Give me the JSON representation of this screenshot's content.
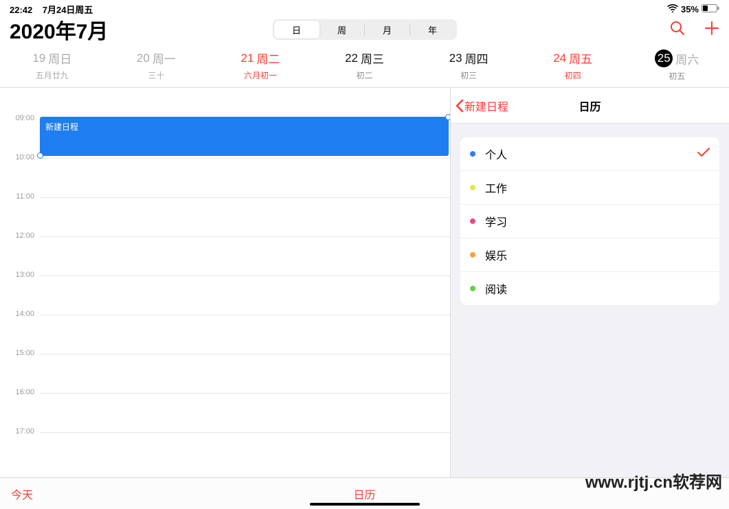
{
  "status": {
    "time": "22:42",
    "date": "7月24日周五",
    "battery_percent": "35%"
  },
  "header": {
    "title": "2020年7月",
    "segments": {
      "day": "日",
      "week": "周",
      "month": "月",
      "year": "年"
    }
  },
  "week": [
    {
      "main_num": "19",
      "main_wd": "周日",
      "sub": "五月廿九",
      "cls": "past"
    },
    {
      "main_num": "20",
      "main_wd": "周一",
      "sub": "三十",
      "cls": "past"
    },
    {
      "main_num": "21",
      "main_wd": "周二",
      "sub": "六月初一",
      "cls": "selected"
    },
    {
      "main_num": "22",
      "main_wd": "周三",
      "sub": "初二",
      "cls": ""
    },
    {
      "main_num": "23",
      "main_wd": "周四",
      "sub": "初三",
      "cls": ""
    },
    {
      "main_num": "24",
      "main_wd": "周五",
      "sub": "初四",
      "cls": "selected"
    },
    {
      "main_num": "25",
      "main_wd": "周六",
      "sub": "初五",
      "cls": "today"
    }
  ],
  "timeline": {
    "hours": [
      "09:00",
      "10:00",
      "11:00",
      "12:00",
      "13:00",
      "14:00",
      "15:00",
      "16:00",
      "17:00"
    ],
    "event": {
      "title": "新建日程"
    }
  },
  "panel": {
    "back_label": "新建日程",
    "title": "日历",
    "calendars": [
      {
        "label": "个人",
        "color": "#2f7ef0",
        "selected": true
      },
      {
        "label": "工作",
        "color": "#e6e64f",
        "selected": false
      },
      {
        "label": "学习",
        "color": "#e84a8c",
        "selected": false
      },
      {
        "label": "娱乐",
        "color": "#f2a33c",
        "selected": false
      },
      {
        "label": "阅读",
        "color": "#5fd24a",
        "selected": false
      }
    ]
  },
  "bottom": {
    "today": "今天",
    "calendars": "日历"
  },
  "watermark": "www.rjtj.cn软荐网"
}
